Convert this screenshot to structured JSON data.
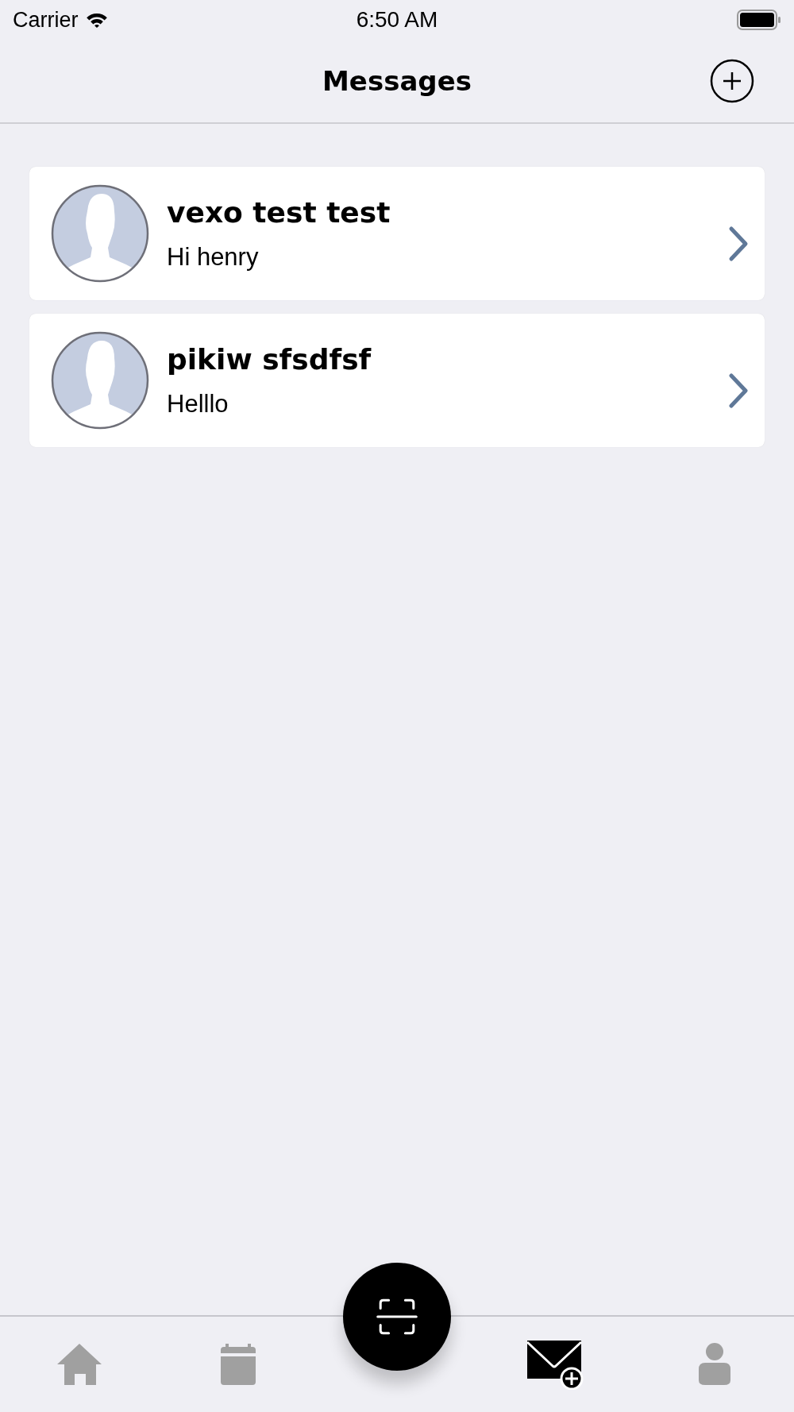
{
  "status_bar": {
    "carrier": "Carrier",
    "time": "6:50 AM"
  },
  "nav_bar": {
    "title": "Messages"
  },
  "conversations": [
    {
      "name": "vexo test test",
      "message": "Hi henry"
    },
    {
      "name": "pikiw sfsdfsf",
      "message": "Helllo"
    }
  ],
  "tab_bar": {
    "tabs": [
      {
        "kind": "home",
        "selected": false
      },
      {
        "kind": "calendar",
        "selected": false
      },
      {
        "kind": "scan",
        "selected": false
      },
      {
        "kind": "mail",
        "selected": true
      },
      {
        "kind": "profile",
        "selected": false
      }
    ]
  }
}
